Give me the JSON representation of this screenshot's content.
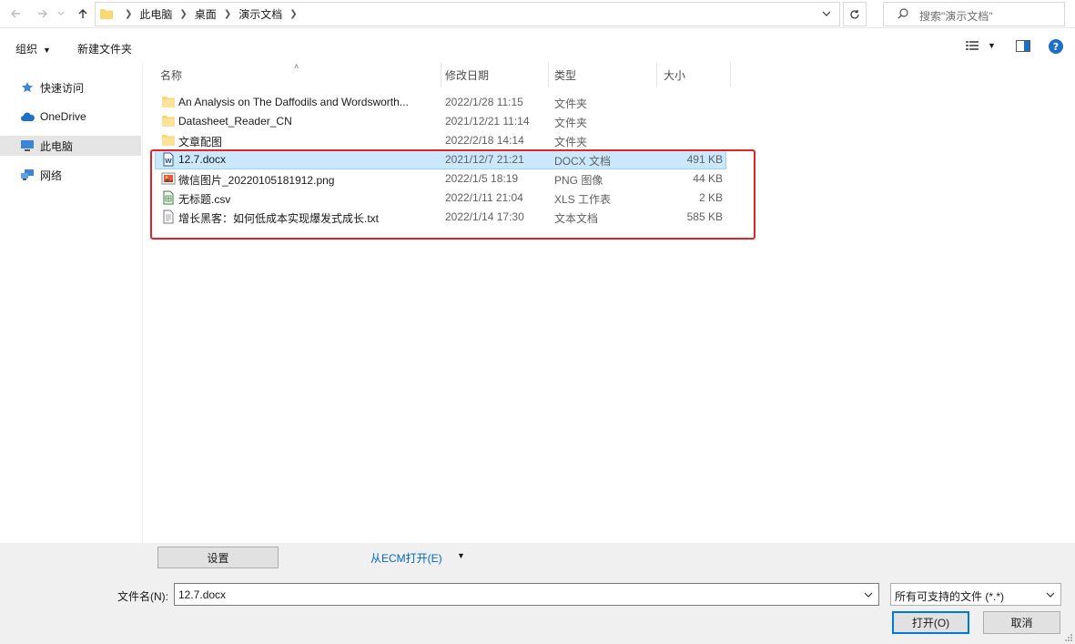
{
  "address": {
    "crumbs": [
      "此电脑",
      "桌面",
      "演示文档"
    ],
    "search_placeholder": "搜索\"演示文档\""
  },
  "toolbar": {
    "organize_label": "组织",
    "new_folder_label": "新建文件夹"
  },
  "sidebar": {
    "items": [
      {
        "label": "快速访问",
        "icon": "star-icon"
      },
      {
        "label": "OneDrive",
        "icon": "cloud-icon"
      },
      {
        "label": "此电脑",
        "icon": "computer-icon",
        "selected": true
      },
      {
        "label": "网络",
        "icon": "network-icon"
      }
    ]
  },
  "columns": {
    "name": "名称",
    "date": "修改日期",
    "type": "类型",
    "size": "大小"
  },
  "files": [
    {
      "name": "An Analysis on The Daffodils and Wordsworth...",
      "date": "2022/1/28 11:15",
      "type": "文件夹",
      "size": "",
      "icon": "folder-icon"
    },
    {
      "name": "Datasheet_Reader_CN",
      "date": "2021/12/21 11:14",
      "type": "文件夹",
      "size": "",
      "icon": "folder-icon"
    },
    {
      "name": "文章配图",
      "date": "2022/2/18 14:14",
      "type": "文件夹",
      "size": "",
      "icon": "folder-icon"
    },
    {
      "name": "12.7.docx",
      "date": "2021/12/7 21:21",
      "type": "DOCX 文档",
      "size": "491 KB",
      "icon": "word-doc-icon",
      "selected": true
    },
    {
      "name": "微信图片_20220105181912.png",
      "date": "2022/1/5 18:19",
      "type": "PNG 图像",
      "size": "44 KB",
      "icon": "image-file-icon"
    },
    {
      "name": "无标题.csv",
      "date": "2022/1/11 21:04",
      "type": "XLS 工作表",
      "size": "2 KB",
      "icon": "spreadsheet-icon"
    },
    {
      "name": "增长黑客：如何低成本实现爆发式成长.txt",
      "date": "2022/1/14 17:30",
      "type": "文本文档",
      "size": "585 KB",
      "icon": "text-file-icon"
    }
  ],
  "bottom": {
    "settings_label": "设置",
    "ecm_label": "从ECM打开(E)",
    "filename_label": "文件名(N):",
    "filename_value": "12.7.docx",
    "filter_value": "所有可支持的文件 (*.*)",
    "open_label": "打开(O)",
    "cancel_label": "取消"
  },
  "colors": {
    "accent": "#0078d7",
    "selection": "#cce8ff",
    "highlight": "#e0242a",
    "folder": "#f8d775"
  }
}
